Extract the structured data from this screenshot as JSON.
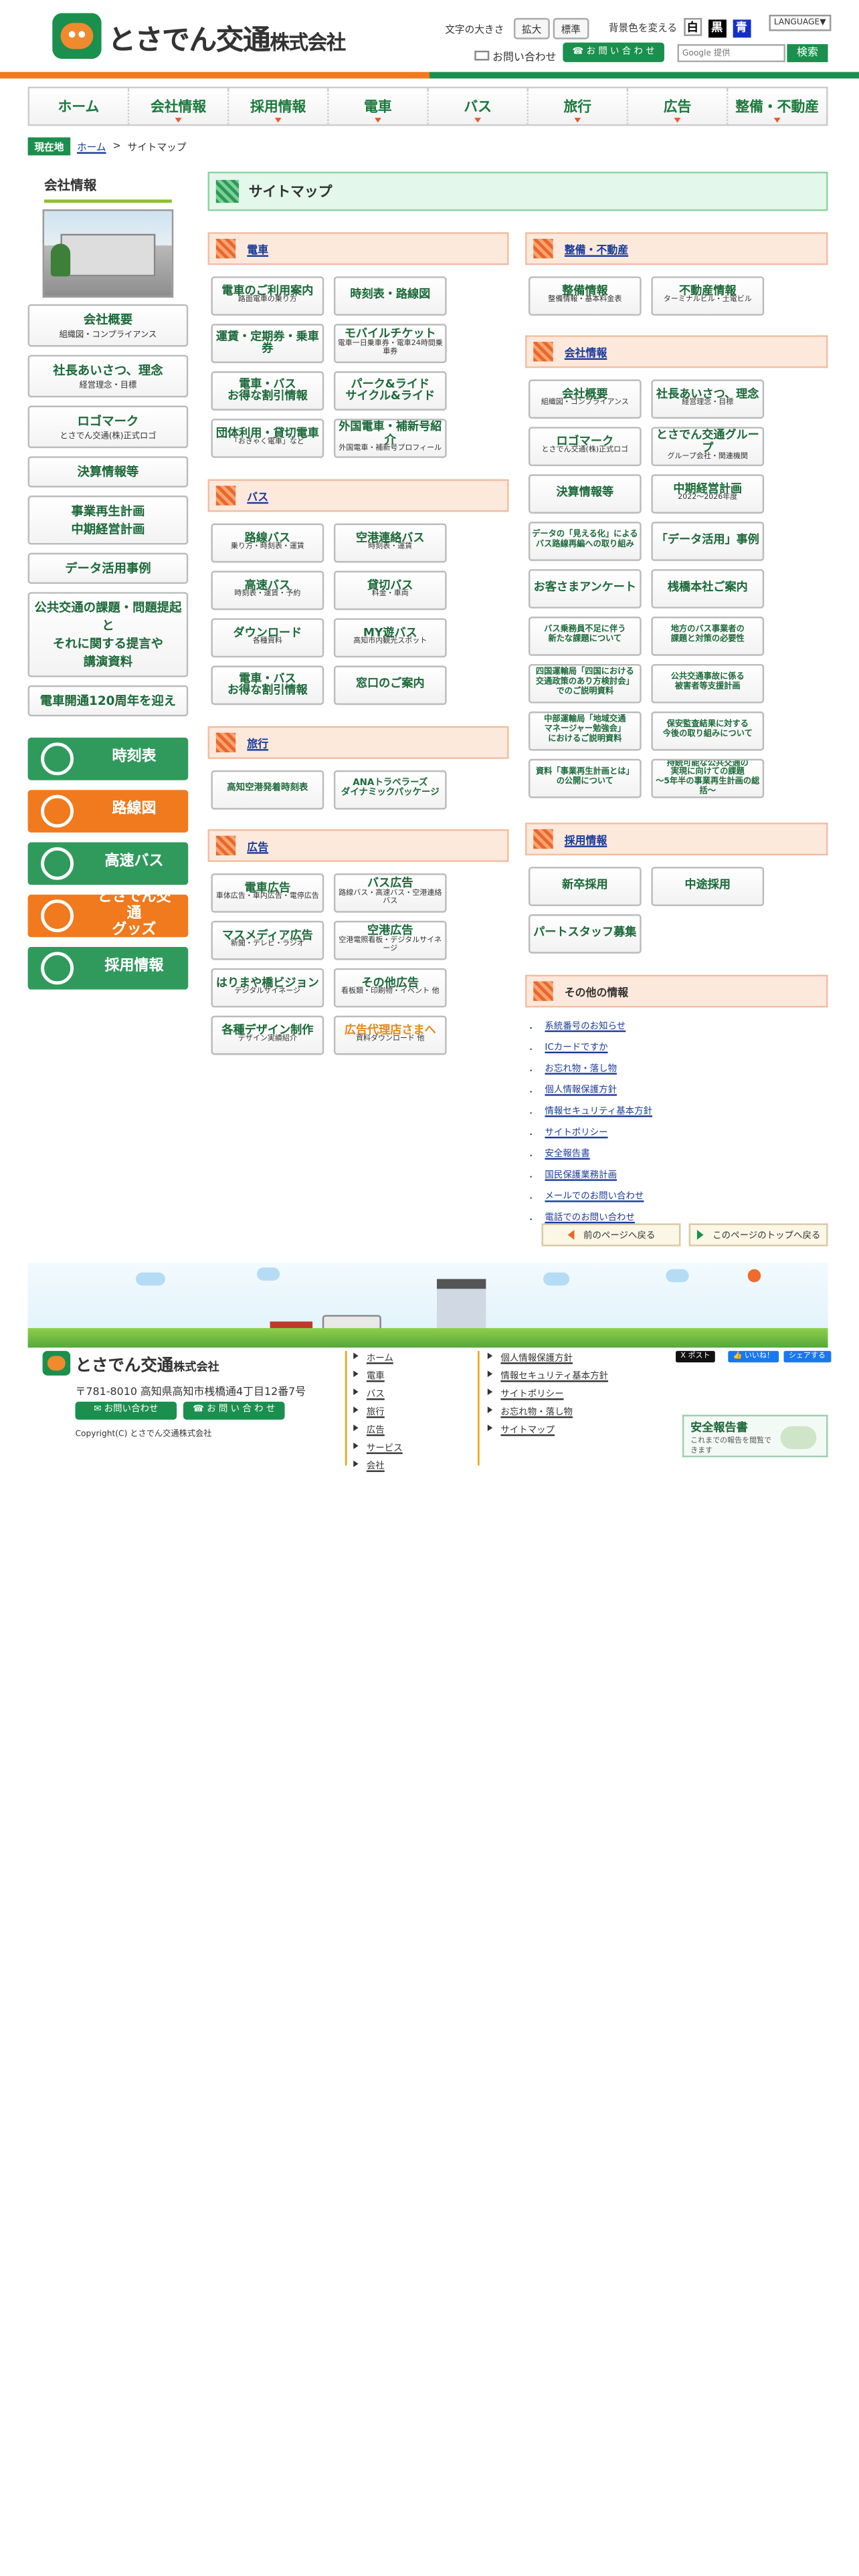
{
  "header": {
    "logo_text": "とさでん交通",
    "logo_suffix": "株式会社",
    "font_size_label": "文字の大きさ",
    "font_size_large": "拡大",
    "font_size_standard": "標準",
    "bg_color_label": "背景色を変える",
    "bg_white": "白",
    "bg_black": "黒",
    "bg_blue": "青",
    "language": "LANGUAGE▼",
    "contact_mail": "お問い合わせ",
    "contact_phone": "お 問 い 合 わ せ",
    "search_placeholder": "Google 提供",
    "search_button": "検索"
  },
  "nav": [
    {
      "label": "ホーム"
    },
    {
      "label": "会社情報"
    },
    {
      "label": "採用情報"
    },
    {
      "label": "電車"
    },
    {
      "label": "バス"
    },
    {
      "label": "旅行"
    },
    {
      "label": "広告"
    },
    {
      "label": "整備・不動産"
    }
  ],
  "breadcrumb": {
    "here": "現在地",
    "home": "ホーム",
    "sep": " > ",
    "current": "サイトマップ"
  },
  "sidebar": {
    "title": "会社情報",
    "boxes": [
      {
        "main": "会社概要",
        "sub": "組織図・コンプライアンス"
      },
      {
        "main": "社長あいさつ、理念",
        "sub": "経営理念・目標"
      },
      {
        "main": "ロゴマーク",
        "sub": "とさでん交通(株)正式ロゴ"
      },
      {
        "main": "決算情報等",
        "sub": ""
      },
      {
        "main": "事業再生計画\n中期経営計画",
        "sub": ""
      },
      {
        "main": "データ活用事例",
        "sub": ""
      },
      {
        "main": "公共交通の課題・問題提起と\nそれに関する提言や\n講演資料",
        "sub": ""
      },
      {
        "main": "電車開通120周年を迎え",
        "sub": ""
      }
    ],
    "banners": [
      {
        "label": "時刻表",
        "color": "#2f9a5c"
      },
      {
        "label": "路線図",
        "color": "#f07a1d"
      },
      {
        "label": "高速バス",
        "color": "#2f9a5c"
      },
      {
        "label": "とさでん交通\nグッズ",
        "color": "#f07a1d"
      },
      {
        "label": "採用情報",
        "color": "#2f9a5c"
      }
    ]
  },
  "main": {
    "title": "サイトマップ",
    "train": {
      "heading": "電車",
      "items": [
        {
          "main": "電車のご利用案内",
          "sub": "路面電車の乗り方"
        },
        {
          "main": "時刻表・路線図",
          "sub": ""
        },
        {
          "main": "運賃・定期券・乗車券",
          "sub": ""
        },
        {
          "main": "モバイルチケット",
          "sub": "電車一日乗車券・電車24時間乗車券"
        },
        {
          "main": "電車・バス\nお得な割引情報",
          "sub": ""
        },
        {
          "main": "パーク&ライド\nサイクル&ライド",
          "sub": ""
        },
        {
          "main": "団体利用・貸切電車",
          "sub": "「おきゃく電車」など"
        },
        {
          "main": "外国電車・補新号紹介",
          "sub": "外国電車・補新号プロフィール"
        }
      ]
    },
    "bus": {
      "heading": "バス",
      "items": [
        {
          "main": "路線バス",
          "sub": "乗り方・時刻表・運賃"
        },
        {
          "main": "空港連絡バス",
          "sub": "時刻表・運賃"
        },
        {
          "main": "高速バス",
          "sub": "時刻表・運賃・予約"
        },
        {
          "main": "貸切バス",
          "sub": "料金・車両"
        },
        {
          "main": "ダウンロード",
          "sub": "各種資料"
        },
        {
          "main": "MY遊バス",
          "sub": "高知市内観光スポット"
        },
        {
          "main": "電車・バス\nお得な割引情報",
          "sub": ""
        },
        {
          "main": "窓口のご案内",
          "sub": ""
        }
      ]
    },
    "travel": {
      "heading": "旅行",
      "items": [
        {
          "main": "高知空港発着時刻表",
          "sub": ""
        },
        {
          "main": "ANAトラベラーズ\nダイナミックパッケージ",
          "sub": ""
        }
      ]
    },
    "ad": {
      "heading": "広告",
      "items": [
        {
          "main": "電車広告",
          "sub": "車体広告・車内広告・電停広告"
        },
        {
          "main": "バス広告",
          "sub": "路線バス・高速バス・空港連絡バス"
        },
        {
          "main": "マスメディア広告",
          "sub": "新聞・テレビ・ラジオ"
        },
        {
          "main": "空港広告",
          "sub": "空港電照看板・デジタルサイネージ"
        },
        {
          "main": "はりまや橋ビジョン",
          "sub": "デジタルサイネージ"
        },
        {
          "main": "その他広告",
          "sub": "看板類・印刷物・イベント 他"
        },
        {
          "main": "各種デザイン制作",
          "sub": "デザイン実績紹介"
        },
        {
          "main": "広告代理店さまへ",
          "sub": "資料ダウンロード 他"
        }
      ]
    },
    "maint": {
      "heading": "整備・不動産",
      "items": [
        {
          "main": "整備情報",
          "sub": "整備情報・基本料金表"
        },
        {
          "main": "不動産情報",
          "sub": "ターミナルビル・土電ビル"
        }
      ]
    },
    "company": {
      "heading": "会社情報",
      "items": [
        {
          "main": "会社概要",
          "sub": "組織図・コンプライアンス"
        },
        {
          "main": "社長あいさつ、理念",
          "sub": "経営理念・目標"
        },
        {
          "main": "ロゴマーク",
          "sub": "とさでん交通(株)正式ロゴ"
        },
        {
          "main": "とさでん交通グループ",
          "sub": "グループ会社・関連機関"
        },
        {
          "main": "決算情報等",
          "sub": ""
        },
        {
          "main": "中期経営計画",
          "sub": "2022〜2026年度"
        },
        {
          "main": "データの「見える化」による\nバス路線再編への取り組み",
          "sub": ""
        },
        {
          "main": "「データ活用」事例",
          "sub": ""
        },
        {
          "main": "お客さまアンケート",
          "sub": ""
        },
        {
          "main": "桟橋本社ご案内",
          "sub": ""
        },
        {
          "main": "バス乗務員不足に伴う\n新たな課題について",
          "sub": ""
        },
        {
          "main": "地方のバス事業者の\n課題と対策の必要性",
          "sub": ""
        },
        {
          "main": "四国運輸局「四国における\n交通政策のあり方検討会」\nでのご説明資料",
          "sub": ""
        },
        {
          "main": "公共交通事故に係る\n被害者等支援計画",
          "sub": ""
        },
        {
          "main": "中部運輸局「地域交通\nマネージャー勉強会」\nにおけるご説明資料",
          "sub": ""
        },
        {
          "main": "保安監査結果に対する\n今後の取り組みについて",
          "sub": ""
        },
        {
          "main": "資料「事業再生計画とは」\nの公開について",
          "sub": ""
        },
        {
          "main": "持続可能な公共交通の\n実現に向けての課題\n〜5年半の事業再生計画の総括〜",
          "sub": ""
        }
      ]
    },
    "recruit": {
      "heading": "採用情報",
      "items": [
        {
          "main": "新卒採用",
          "sub": ""
        },
        {
          "main": "中途採用",
          "sub": ""
        },
        {
          "main": "パートスタッフ募集",
          "sub": ""
        }
      ]
    },
    "other": {
      "heading": "その他の情報",
      "links": [
        "系統番号のお知らせ",
        "ICカードですか",
        "お忘れ物・落し物",
        "個人情報保護方針",
        "情報セキュリティ基本方針",
        "サイトポリシー",
        "安全報告書",
        "国民保護業務計画",
        "メールでのお問い合わせ",
        "電話でのお問い合わせ"
      ]
    },
    "back_button": "前のページへ戻る",
    "top_button": "このページのトップへ戻る"
  },
  "footer": {
    "logo_text": "とさでん交通",
    "logo_suffix": "株式会社",
    "address": "〒781-8010 高知県高知市桟橋通4丁目12番7号",
    "mail_button": "お問い合わせ",
    "phone_button": "お 問 い 合 わ せ",
    "copyright": "Copyright(C) とさでん交通株式会社",
    "col1": [
      "ホーム",
      "電車",
      "バス",
      "旅行",
      "広告",
      "サービス",
      "会社"
    ],
    "col2": [
      "個人情報保護方針",
      "情報セキュリティ基本方針",
      "サイトポリシー",
      "お忘れ物・落し物",
      "サイトマップ"
    ],
    "post": "X ポスト",
    "like": "👍 いいね！",
    "share": "シェアする",
    "safety_title": "安全報告書",
    "safety_sub": "これまでの報告を閲覧できます"
  }
}
